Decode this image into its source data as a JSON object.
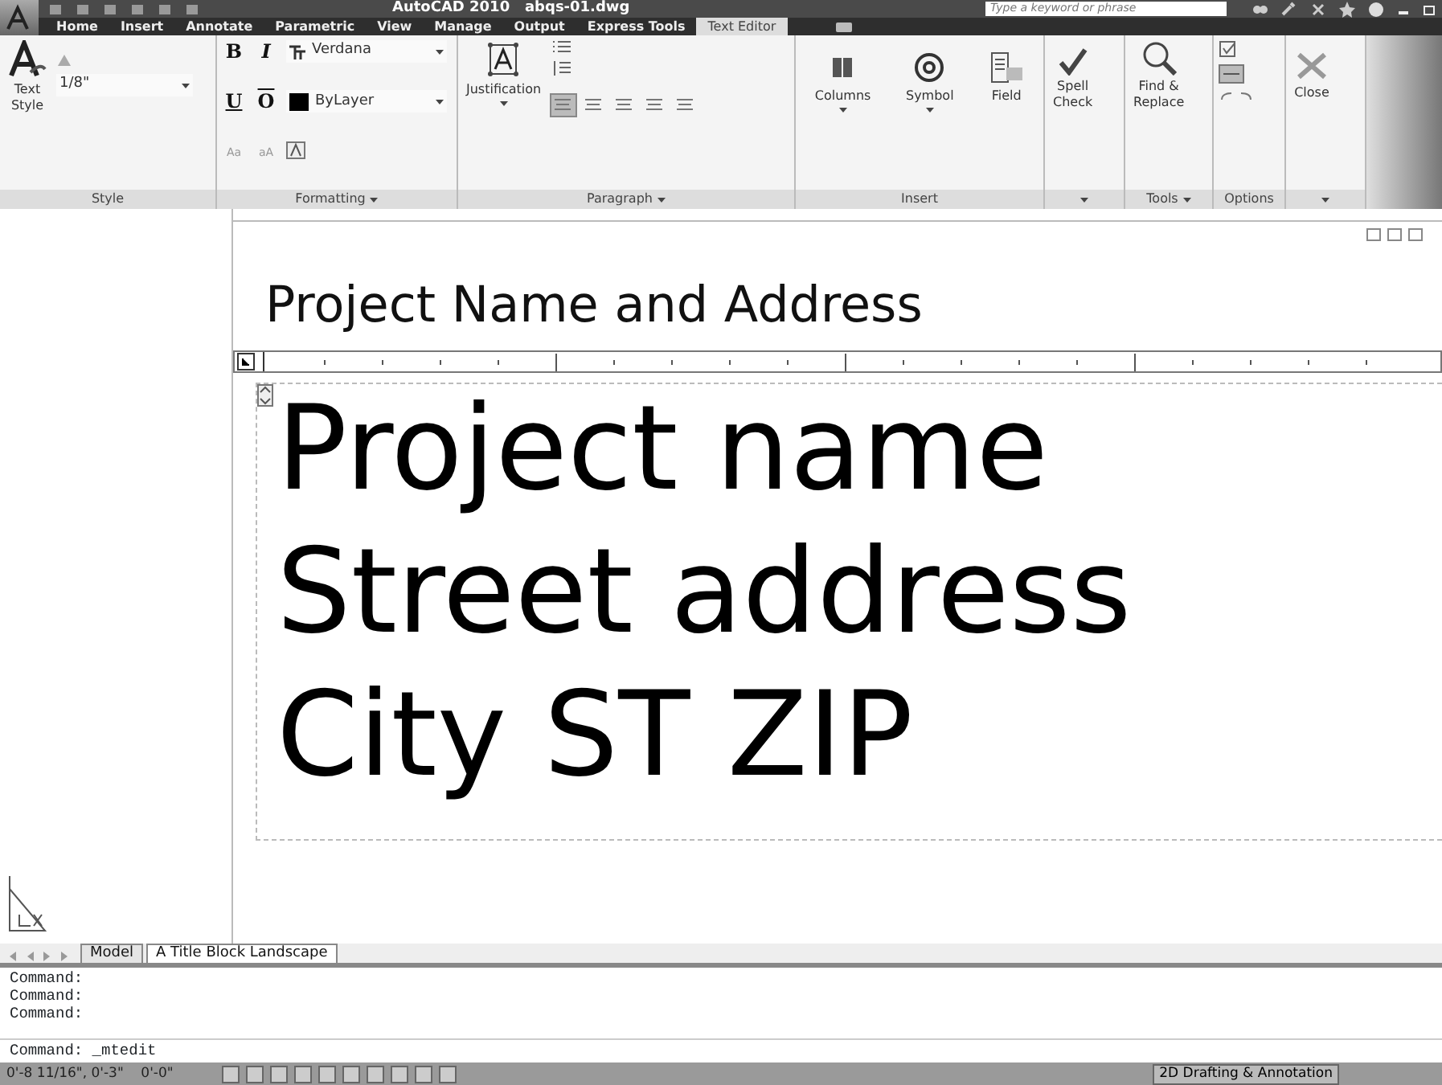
{
  "title_bar": {
    "title": "AutoCAD 2010   abqs-01.dwg",
    "search": {
      "placeholder": "Type a keyword or phrase"
    }
  },
  "ribbon_tabs": [
    {
      "label": "Home",
      "selected": false
    },
    {
      "label": "Insert",
      "selected": false
    },
    {
      "label": "Annotate",
      "selected": false
    },
    {
      "label": "Parametric",
      "selected": false
    },
    {
      "label": "View",
      "selected": false
    },
    {
      "label": "Manage",
      "selected": false
    },
    {
      "label": "Output",
      "selected": false
    },
    {
      "label": "Express Tools",
      "selected": false
    },
    {
      "label": "Text Editor",
      "selected": true
    }
  ],
  "panels": {
    "style": {
      "title": "Style",
      "text_style": "Text\nStyle",
      "height": "1/8\""
    },
    "formatting": {
      "title": "Formatting",
      "bold": "B",
      "italic": "I",
      "underline": "U",
      "overline": "O",
      "font": "Verdana",
      "font_color": "ByLayer",
      "uppercase": "Aa",
      "lowercase": "aA"
    },
    "paragraph": {
      "title": "Paragraph",
      "justification": "Justification",
      "alignments": [
        {
          "selected": true
        },
        {
          "selected": false
        },
        {
          "selected": false
        },
        {
          "selected": false
        },
        {
          "selected": false
        }
      ]
    },
    "insert": {
      "title": "Insert",
      "buttons": [
        "Columns",
        "Symbol",
        "Field"
      ]
    },
    "spell": {
      "label": "Spell\nCheck"
    },
    "tools": {
      "title": "Tools",
      "label": "Find &\nReplace"
    },
    "options": {
      "title": "Options"
    },
    "close": {
      "label": "Close"
    }
  },
  "drawing": {
    "heading": "Project Name and Address",
    "mtext_lines": [
      "Project name",
      "Street address",
      "City ST ZIP"
    ]
  },
  "layout_tabs": [
    {
      "label": "Model",
      "selected": false
    },
    {
      "label": "A Title Block Landscape",
      "selected": true
    }
  ],
  "command_lines": [
    "Command:",
    "Command:",
    "Command:"
  ],
  "command_input": "Command:  _mtedit",
  "status_bar": {
    "coordinates": "0'-8 11/16\", 0'-3\"    0'-0\"",
    "workspace": "2D Drafting & Annotation"
  }
}
